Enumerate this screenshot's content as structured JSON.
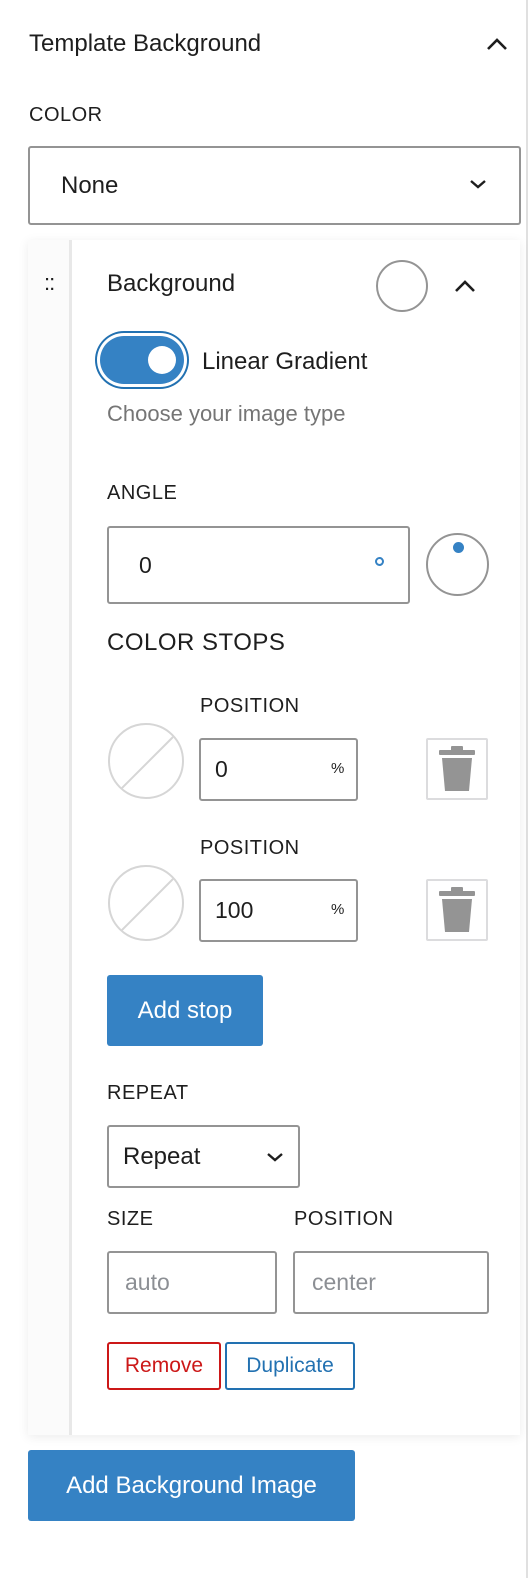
{
  "panel": {
    "title": "Template Background",
    "color_label": "COLOR",
    "color_select_value": "None"
  },
  "item": {
    "drag_handle_glyph": "::",
    "title": "Background",
    "toggle_label": "Linear Gradient",
    "toggle_on": true,
    "help_text": "Choose your image type",
    "angle_label": "ANGLE",
    "angle_value": "0",
    "color_stops_label": "COLOR STOPS",
    "stops": [
      {
        "position_label": "POSITION",
        "position_value": "0",
        "unit": "%"
      },
      {
        "position_label": "POSITION",
        "position_value": "100",
        "unit": "%"
      }
    ],
    "add_stop_label": "Add stop",
    "repeat_label": "REPEAT",
    "repeat_value": "Repeat",
    "size_label": "SIZE",
    "size_placeholder": "auto",
    "position_label": "POSITION",
    "position_placeholder": "center",
    "remove_label": "Remove",
    "duplicate_label": "Duplicate"
  },
  "add_background_image_label": "Add Background Image",
  "colors": {
    "accent": "#3582c4",
    "danger": "#cc1818",
    "link": "#2271b1",
    "border": "#949494",
    "muted": "#757575"
  },
  "icons": {
    "panel_toggle": "chevron-up-icon",
    "select_chevron": "chevron-down-icon",
    "drag": "drag-handle-icon",
    "color_swatch": "color-swatch-icon",
    "angle_dial": "angle-picker-icon",
    "delete": "trash-icon"
  }
}
